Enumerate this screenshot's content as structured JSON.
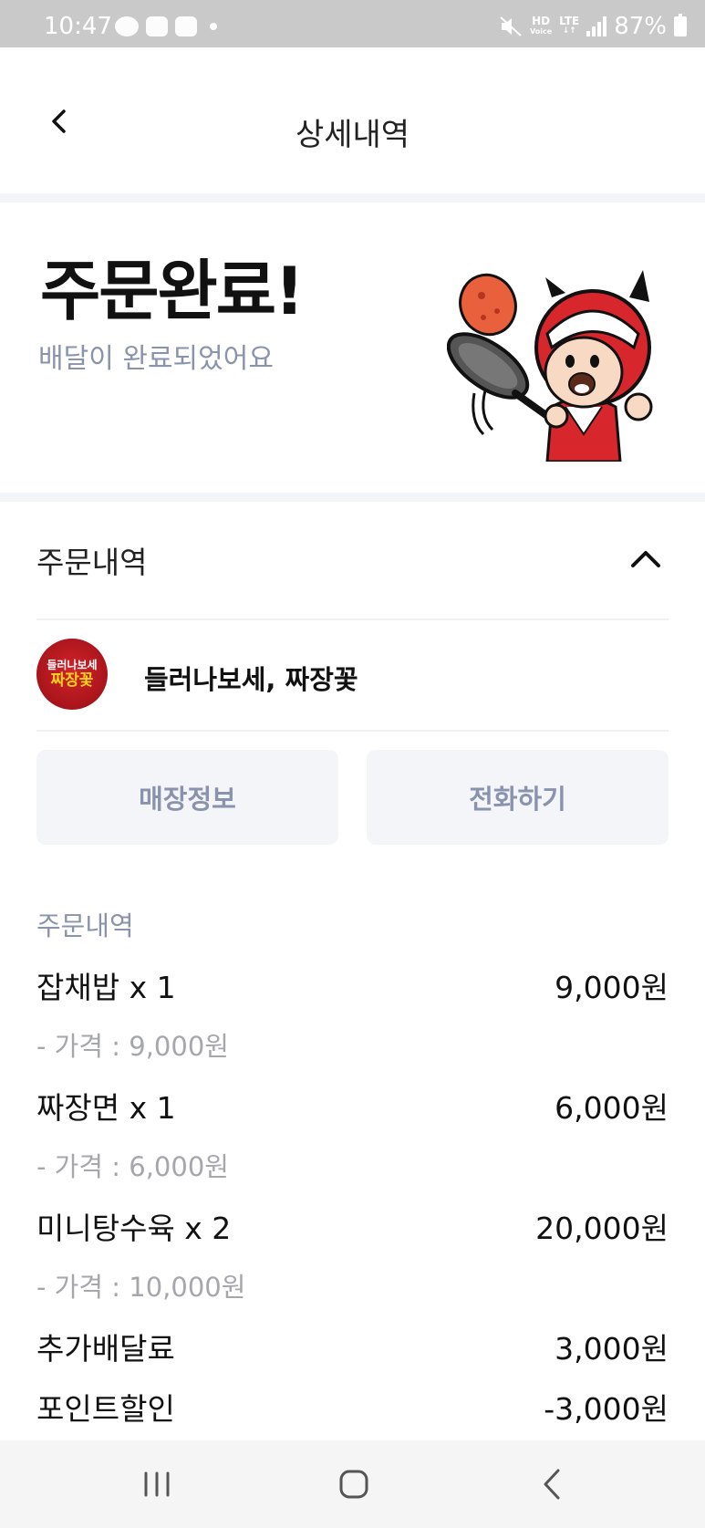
{
  "status_bar": {
    "time": "10:47",
    "network_hd": "HD",
    "network_voice": "Voice",
    "network_lte": "LTE",
    "battery": "87%"
  },
  "header": {
    "title": "상세내역",
    "back_icon": "chevron-left-icon"
  },
  "hero": {
    "title": "주문완료!",
    "subtitle": "배달이 완료되었어요",
    "mascot_icon": "chef-mascot-icon"
  },
  "order": {
    "section_title": "주문내역",
    "collapse_icon": "chevron-up-icon",
    "store": {
      "name": "들러나보세, 짜장꽃",
      "logo_top": "들러나보세",
      "logo_main": "짜장꽃"
    },
    "buttons": {
      "store_info": "매장정보",
      "call": "전화하기"
    },
    "items_label": "주문내역",
    "items": [
      {
        "name": "잡채밥 x 1",
        "price": "9,000원",
        "detail": "- 가격 : 9,000원"
      },
      {
        "name": "짜장면 x 1",
        "price": "6,000원",
        "detail": "- 가격 : 6,000원"
      },
      {
        "name": "미니탕수육 x 2",
        "price": "20,000원",
        "detail": "- 가격 : 10,000원"
      }
    ],
    "extra": [
      {
        "name": "추가배달료",
        "price": "3,000원"
      },
      {
        "name": "포인트할인",
        "price": "-3,000원"
      }
    ]
  },
  "colors": {
    "accent_text": "#8a93ad",
    "button_bg": "#f4f5f9",
    "mascot_red": "#d8262d"
  }
}
